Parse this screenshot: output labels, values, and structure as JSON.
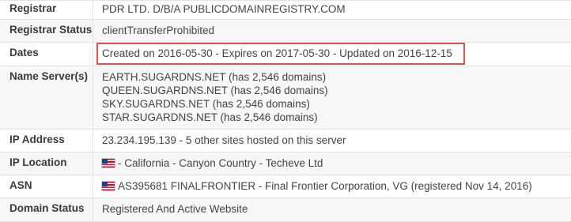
{
  "rows": {
    "registrar": {
      "label": "Registrar",
      "value": "PDR LTD. D/B/A PUBLICDOMAINREGISTRY.COM"
    },
    "registrar_status": {
      "label": "Registrar Status",
      "value": "clientTransferProhibited"
    },
    "dates": {
      "label": "Dates",
      "value": "Created on 2016-05-30 - Expires on 2017-05-30 - Updated on 2016-12-15"
    },
    "name_servers": {
      "label": "Name Server(s)",
      "values": [
        "EARTH.SUGARDNS.NET (has 2,546 domains)",
        "QUEEN.SUGARDNS.NET (has 2,546 domains)",
        "SKY.SUGARDNS.NET (has 2,546 domains)",
        "STAR.SUGARDNS.NET (has 2,546 domains)"
      ]
    },
    "ip_address": {
      "label": "IP Address",
      "value": "23.234.195.139 - 5 other sites hosted on this server"
    },
    "ip_location": {
      "label": "IP Location",
      "value": "- California - Canyon Country - Techeve Ltd",
      "flag_icon": "us-flag-icon"
    },
    "asn": {
      "label": "ASN",
      "value": "AS395681 FINALFRONTIER - Final Frontier Corporation, VG (registered Nov 14, 2016)",
      "flag_icon": "us-flag-icon"
    },
    "domain_status": {
      "label": "Domain Status",
      "value": "Registered And Active Website"
    }
  },
  "colors": {
    "highlight_border": "#d9534f",
    "row_alt_bg": "#f7f7f7",
    "divider": "#e3e3e3"
  }
}
